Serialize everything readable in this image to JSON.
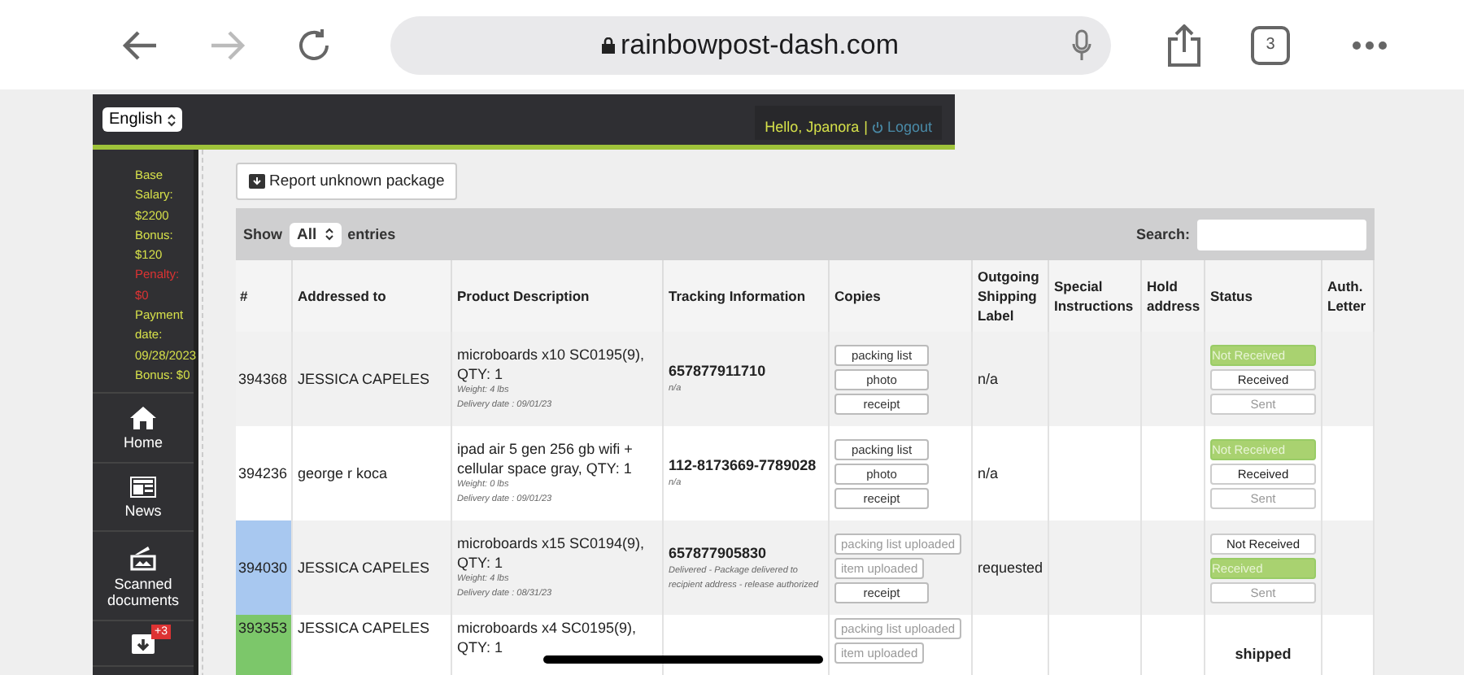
{
  "browser": {
    "url": "rainbowpost-dash.com",
    "tab_count": "3"
  },
  "header": {
    "language": "English",
    "greeting": "Hello, Jpanora",
    "separator": "|",
    "logout": "Logout"
  },
  "sidebar": {
    "info": [
      {
        "text": "Base Salary: $2200",
        "kind": "normal"
      },
      {
        "text": "Bonus: $120",
        "kind": "normal"
      },
      {
        "text": "Penalty: $0",
        "kind": "penalty"
      },
      {
        "text": "Payment date: 09/28/2023",
        "kind": "normal"
      },
      {
        "text": "Bonus: $0",
        "kind": "normal"
      }
    ],
    "items": [
      {
        "label": "Home"
      },
      {
        "label": "News"
      },
      {
        "label": "Scanned documents"
      },
      {
        "badge": "+3"
      }
    ]
  },
  "report_button": "Report unknown package",
  "table_controls": {
    "show": "Show",
    "entries_value": "All",
    "entries": "entries",
    "search_label": "Search:"
  },
  "table": {
    "columns": [
      "#",
      "Addressed to",
      "Product Description",
      "Tracking Information",
      "Copies",
      "Outgoing Shipping Label",
      "Special Instructions",
      "Hold address",
      "Status",
      "Auth. Letter"
    ],
    "rows": [
      {
        "id": "394368",
        "addressed_to": "JESSICA CAPELES",
        "product": "microboards x10 SC0195(9), QTY: 1",
        "weight": "Weight: 4 lbs",
        "delivery": "Delivery date : 09/01/23",
        "tracking": "657877911710",
        "tracking_note": "n/a",
        "copies": [
          {
            "label": "packing list",
            "uploaded": false
          },
          {
            "label": "photo",
            "uploaded": false
          },
          {
            "label": "receipt",
            "uploaded": false
          }
        ],
        "outgoing": "n/a",
        "status": {
          "kind": "buttons",
          "options": [
            {
              "label": "Not Received",
              "selected": true,
              "disabled": false
            },
            {
              "label": "Received",
              "selected": false,
              "disabled": false
            },
            {
              "label": "Sent",
              "selected": false,
              "disabled": true
            }
          ]
        }
      },
      {
        "id": "394236",
        "addressed_to": "george r koca",
        "product": "ipad air 5 gen 256 gb wifi + cellular space gray, QTY: 1",
        "weight": "Weight: 0 lbs",
        "delivery": "Delivery date : 09/01/23",
        "tracking": "112-8173669-7789028",
        "tracking_note": "n/a",
        "copies": [
          {
            "label": "packing list",
            "uploaded": false
          },
          {
            "label": "photo",
            "uploaded": false
          },
          {
            "label": "receipt",
            "uploaded": false
          }
        ],
        "outgoing": "n/a",
        "status": {
          "kind": "buttons",
          "options": [
            {
              "label": "Not Received",
              "selected": true,
              "disabled": false
            },
            {
              "label": "Received",
              "selected": false,
              "disabled": false
            },
            {
              "label": "Sent",
              "selected": false,
              "disabled": true
            }
          ]
        }
      },
      {
        "id": "394030",
        "color": "#a8c8f0",
        "addressed_to": "JESSICA CAPELES",
        "product": "microboards x15 SC0194(9), QTY: 1",
        "weight": "Weight: 4 lbs",
        "delivery": "Delivery date : 08/31/23",
        "tracking": "657877905830",
        "tracking_note": "Delivered - Package delivered to recipient address - release authorized",
        "copies": [
          {
            "label": "packing list uploaded",
            "uploaded": true
          },
          {
            "label": "item uploaded",
            "uploaded": true
          },
          {
            "label": "receipt",
            "uploaded": false
          }
        ],
        "outgoing": "requested",
        "status": {
          "kind": "buttons",
          "options": [
            {
              "label": "Not Received",
              "selected": false,
              "disabled": false
            },
            {
              "label": "Received",
              "selected": true,
              "disabled": false
            },
            {
              "label": "Sent",
              "selected": false,
              "disabled": true
            }
          ]
        }
      },
      {
        "id": "393353",
        "color": "#7cc76a",
        "addressed_to": "JESSICA CAPELES",
        "product": "microboards x4 SC0195(9), QTY: 1",
        "copies": [
          {
            "label": "packing list uploaded",
            "uploaded": true
          },
          {
            "label": "item uploaded",
            "uploaded": true
          }
        ],
        "status": {
          "kind": "text",
          "text": "shipped"
        }
      }
    ]
  }
}
